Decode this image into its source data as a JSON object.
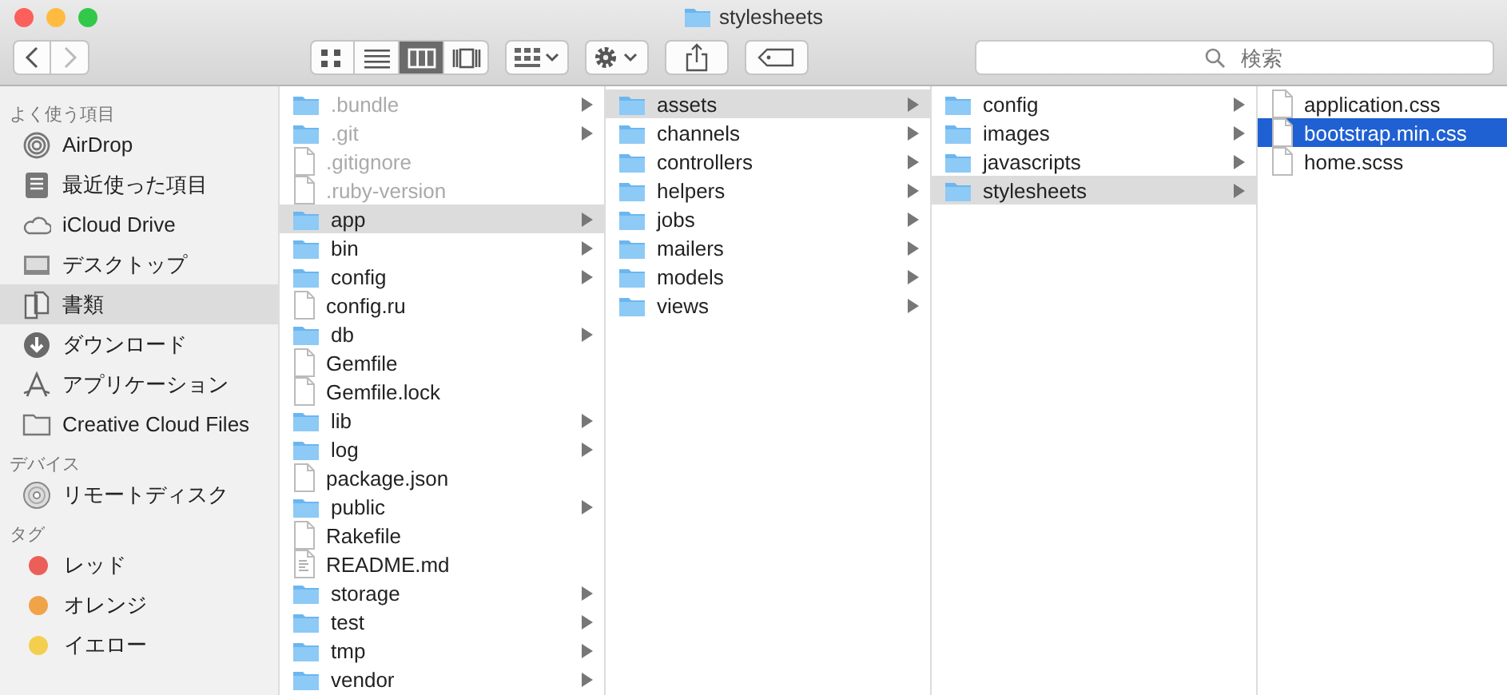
{
  "window": {
    "title": "stylesheets"
  },
  "toolbar": {
    "nav": [
      {
        "kind": "back",
        "disabled": false
      },
      {
        "kind": "forward",
        "disabled": true
      }
    ],
    "view_modes": [
      {
        "kind": "icons",
        "selected": false
      },
      {
        "kind": "list",
        "selected": false
      },
      {
        "kind": "columns",
        "selected": true
      },
      {
        "kind": "gallery",
        "selected": false
      }
    ],
    "search": {
      "placeholder": "検索"
    }
  },
  "sidebar": {
    "sections": [
      {
        "heading": "よく使う項目",
        "items": [
          {
            "label": "AirDrop",
            "kind": "airdrop",
            "selected": false
          },
          {
            "label": "最近使った項目",
            "kind": "recent",
            "selected": false
          },
          {
            "label": "iCloud Drive",
            "kind": "cloud",
            "selected": false
          },
          {
            "label": "デスクトップ",
            "kind": "desktop",
            "selected": false
          },
          {
            "label": "書類",
            "kind": "documents",
            "selected": true
          },
          {
            "label": "ダウンロード",
            "kind": "download",
            "selected": false
          },
          {
            "label": "アプリケーション",
            "kind": "apps",
            "selected": false
          },
          {
            "label": "Creative Cloud Files",
            "kind": "folder",
            "selected": false
          }
        ]
      },
      {
        "heading": "デバイス",
        "items": [
          {
            "label": "リモートディスク",
            "kind": "disc",
            "selected": false
          }
        ]
      },
      {
        "heading": "タグ",
        "items": [
          {
            "label": "レッド",
            "kind": "tag",
            "color": "#ec5f58",
            "selected": false
          },
          {
            "label": "オレンジ",
            "kind": "tag",
            "color": "#f0a347",
            "selected": false
          },
          {
            "label": "イエロー",
            "kind": "tag",
            "color": "#f4cf4f",
            "selected": false
          }
        ]
      }
    ]
  },
  "columns": [
    {
      "focused": false,
      "items": [
        {
          "name": ".bundle",
          "kind": "folder",
          "hidden": true,
          "selected": false
        },
        {
          "name": ".git",
          "kind": "folder",
          "hidden": true,
          "selected": false
        },
        {
          "name": ".gitignore",
          "kind": "file",
          "hidden": true,
          "selected": false
        },
        {
          "name": ".ruby-version",
          "kind": "file",
          "hidden": true,
          "selected": false
        },
        {
          "name": "app",
          "kind": "folder",
          "hidden": false,
          "selected": true
        },
        {
          "name": "bin",
          "kind": "folder",
          "hidden": false,
          "selected": false
        },
        {
          "name": "config",
          "kind": "folder",
          "hidden": false,
          "selected": false
        },
        {
          "name": "config.ru",
          "kind": "file",
          "hidden": false,
          "selected": false
        },
        {
          "name": "db",
          "kind": "folder",
          "hidden": false,
          "selected": false
        },
        {
          "name": "Gemfile",
          "kind": "file",
          "hidden": false,
          "selected": false
        },
        {
          "name": "Gemfile.lock",
          "kind": "file",
          "hidden": false,
          "selected": false
        },
        {
          "name": "lib",
          "kind": "folder",
          "hidden": false,
          "selected": false
        },
        {
          "name": "log",
          "kind": "folder",
          "hidden": false,
          "selected": false
        },
        {
          "name": "package.json",
          "kind": "file",
          "hidden": false,
          "selected": false
        },
        {
          "name": "public",
          "kind": "folder",
          "hidden": false,
          "selected": false
        },
        {
          "name": "Rakefile",
          "kind": "file",
          "hidden": false,
          "selected": false
        },
        {
          "name": "README.md",
          "kind": "text",
          "hidden": false,
          "selected": false
        },
        {
          "name": "storage",
          "kind": "folder",
          "hidden": false,
          "selected": false
        },
        {
          "name": "test",
          "kind": "folder",
          "hidden": false,
          "selected": false
        },
        {
          "name": "tmp",
          "kind": "folder",
          "hidden": false,
          "selected": false
        },
        {
          "name": "vendor",
          "kind": "folder",
          "hidden": false,
          "selected": false
        }
      ]
    },
    {
      "focused": false,
      "items": [
        {
          "name": "assets",
          "kind": "folder",
          "hidden": false,
          "selected": true
        },
        {
          "name": "channels",
          "kind": "folder",
          "hidden": false,
          "selected": false
        },
        {
          "name": "controllers",
          "kind": "folder",
          "hidden": false,
          "selected": false
        },
        {
          "name": "helpers",
          "kind": "folder",
          "hidden": false,
          "selected": false
        },
        {
          "name": "jobs",
          "kind": "folder",
          "hidden": false,
          "selected": false
        },
        {
          "name": "mailers",
          "kind": "folder",
          "hidden": false,
          "selected": false
        },
        {
          "name": "models",
          "kind": "folder",
          "hidden": false,
          "selected": false
        },
        {
          "name": "views",
          "kind": "folder",
          "hidden": false,
          "selected": false
        }
      ]
    },
    {
      "focused": false,
      "items": [
        {
          "name": "config",
          "kind": "folder",
          "hidden": false,
          "selected": false
        },
        {
          "name": "images",
          "kind": "folder",
          "hidden": false,
          "selected": false
        },
        {
          "name": "javascripts",
          "kind": "folder",
          "hidden": false,
          "selected": false
        },
        {
          "name": "stylesheets",
          "kind": "folder",
          "hidden": false,
          "selected": true
        }
      ]
    },
    {
      "focused": true,
      "items": [
        {
          "name": "application.css",
          "kind": "file",
          "hidden": false,
          "selected": false
        },
        {
          "name": "bootstrap.min.css",
          "kind": "file",
          "hidden": false,
          "selected": true
        },
        {
          "name": "home.scss",
          "kind": "file",
          "hidden": false,
          "selected": false
        }
      ]
    }
  ]
}
